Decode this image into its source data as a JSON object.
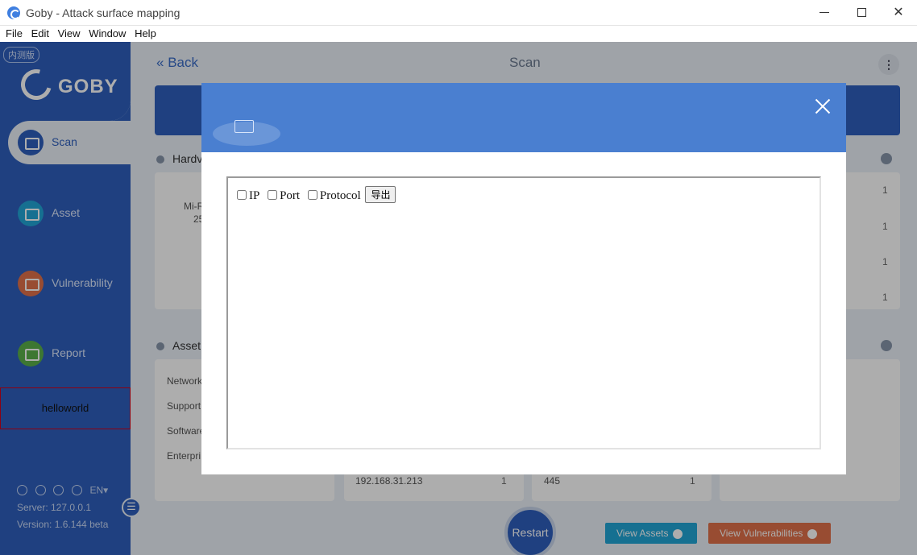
{
  "window": {
    "title": "Goby - Attack surface mapping"
  },
  "menu": [
    "File",
    "Edit",
    "View",
    "Window",
    "Help"
  ],
  "sidebar": {
    "badge": "内测版",
    "logo_text": "GOBY",
    "items": [
      {
        "label": "Scan"
      },
      {
        "label": "Asset"
      },
      {
        "label": "Vulnerability"
      },
      {
        "label": "Report"
      }
    ],
    "plugin_label": "helloworld",
    "language": "EN",
    "server": "Server: 127.0.0.1",
    "version": "Version: 1.6.144 beta"
  },
  "main": {
    "back": "Back",
    "title": "Scan",
    "hardware_title": "Hardv",
    "hardware_label": "Mi-R",
    "hardware_value": "25",
    "asset_title": "Asset",
    "asset_rows": [
      "Network",
      "Support",
      "Software",
      "Enterpri"
    ],
    "counts": [
      "1",
      "1",
      "1",
      "1"
    ],
    "bottom_ip": "192.168.31.213",
    "bottom_ip_count": "1",
    "bottom_port": "445",
    "bottom_port_count": "1",
    "restart": "Restart",
    "view_assets": "View Assets",
    "view_vulns": "View Vulnerabilities"
  },
  "modal": {
    "options": [
      "IP",
      "Port",
      "Protocol"
    ],
    "export_label": "导出"
  }
}
